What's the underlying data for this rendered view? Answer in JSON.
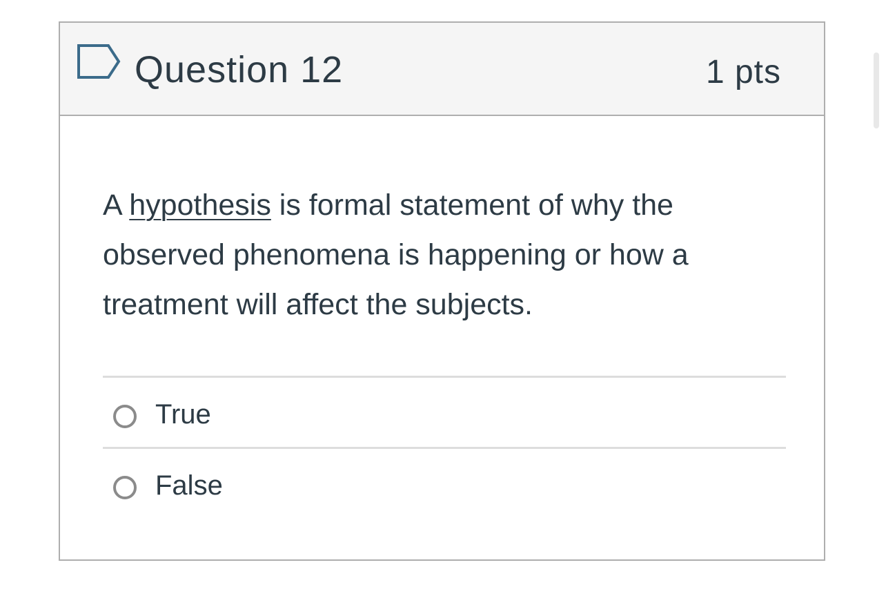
{
  "question": {
    "title": "Question 12",
    "points": "1 pts",
    "flag_icon": "flag-outline-icon",
    "text_before": "A ",
    "text_emphasis": "hypothesis",
    "text_after": " is formal statement of why the observed phenomena is happening or how a treatment will affect the subjects."
  },
  "answers": [
    {
      "label": "True",
      "selected": false
    },
    {
      "label": "False",
      "selected": false
    }
  ],
  "colors": {
    "header_bg": "#f5f5f5",
    "border": "#aeaeae",
    "text": "#2d3b45",
    "flag": "#3b6b8a",
    "radio_border": "#8b8b8b"
  }
}
